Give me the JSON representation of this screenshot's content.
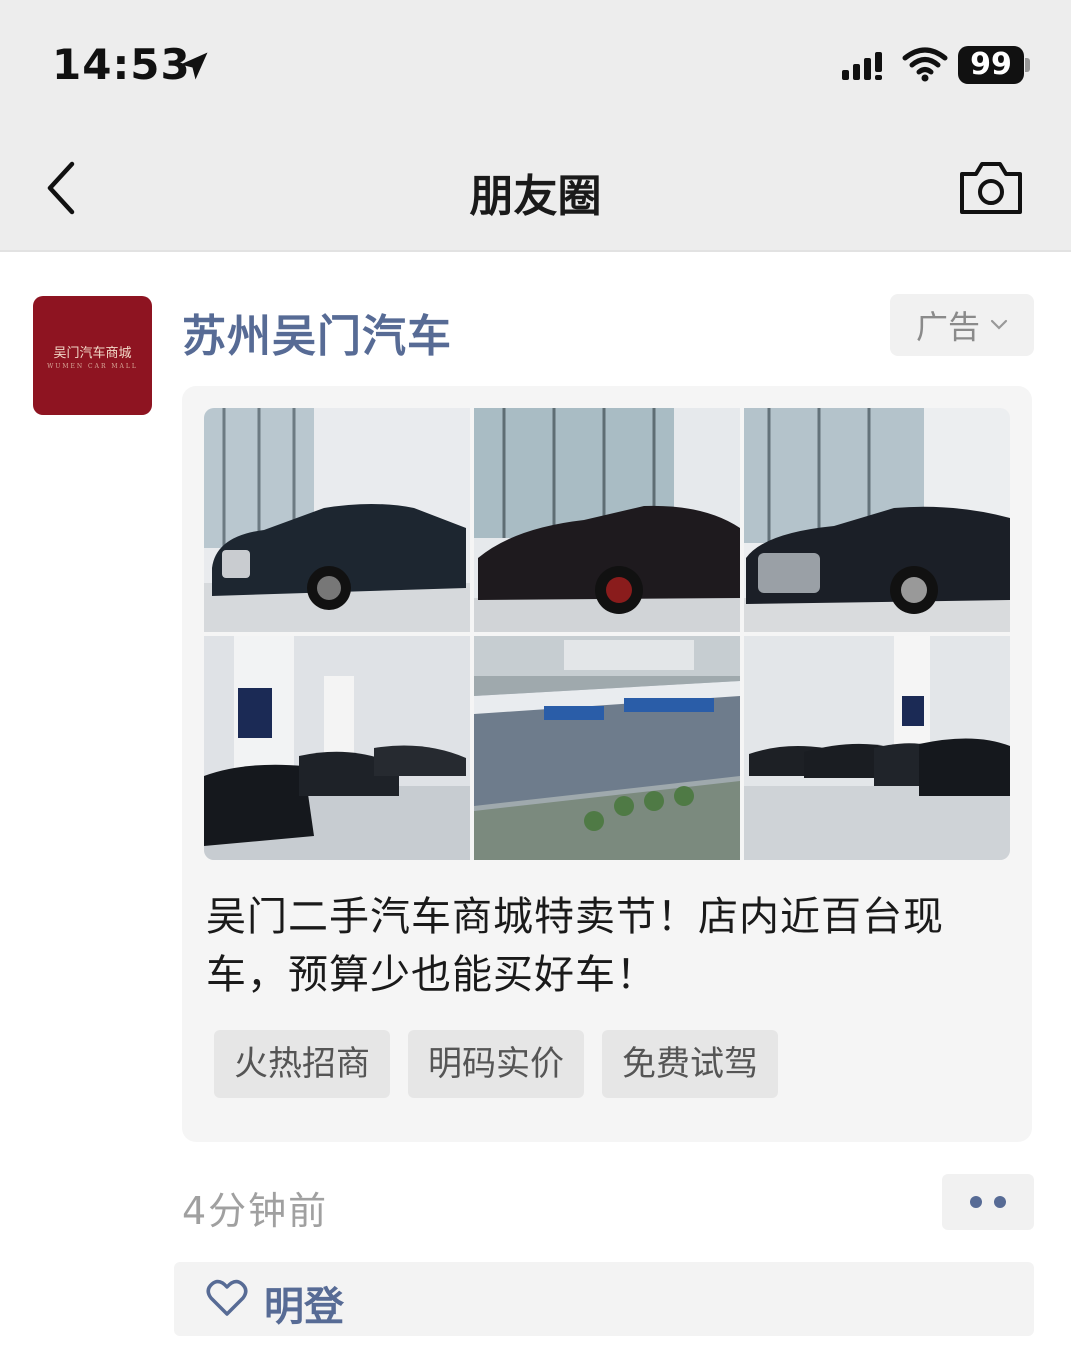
{
  "status_bar": {
    "time": "14:53",
    "battery": "99"
  },
  "nav": {
    "title": "朋友圈"
  },
  "post": {
    "avatar_text": "吴门汽车商城",
    "avatar_subtext": "WUMEN CAR MALL",
    "poster_name": "苏州吴门汽车",
    "ad_label": "广告",
    "ad_text": "吴门二手汽车商城特卖节！店内近百台现车，预算少也能买好车！",
    "chips": [
      "火热招商",
      "明码实价",
      "免费试驾"
    ],
    "timestamp": "4分钟前",
    "liked_by": "明登"
  },
  "colors": {
    "link": "#576b95",
    "avatar_bg": "#8e1421",
    "nav_bg": "#ededed"
  },
  "icons": [
    "location-arrow-icon",
    "signal-icon",
    "wifi-icon",
    "back-icon",
    "camera-icon",
    "chevron-down-icon",
    "heart-icon"
  ]
}
